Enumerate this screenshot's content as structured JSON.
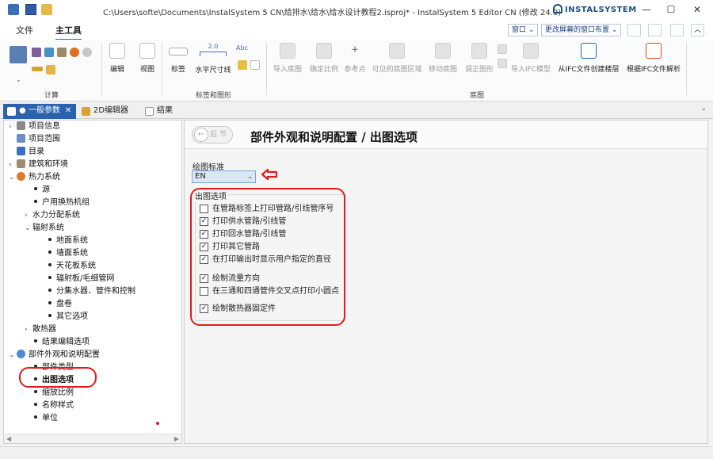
{
  "titlebar": {
    "title": "C:\\Users\\softe\\Documents\\InstalSystem 5 CN\\给排水\\给水\\给水设计教程2.isproj* - InstalSystem 5 Editor CN (修改 24.0)",
    "logo": "INSTALSYSTEM"
  },
  "ribbon_tabs": {
    "file": "文件",
    "main": "主工具",
    "window_label": "窗口",
    "layout_label": "更改屏幕的窗口布置"
  },
  "ribbon": {
    "groups": {
      "calc": "计算",
      "labels": "标签和图形",
      "bottom": "底图"
    },
    "buttons": {
      "edit": "编辑",
      "view": "视图",
      "label": "标签",
      "dim": "水平尺寸线",
      "import_bg": "导入底图",
      "scale": "确定比例",
      "ref": "参考点",
      "visible": "可见的底图区域",
      "move_bg": "移动底图",
      "adjust": "调正图形",
      "import_ifc": "导入IFC模型",
      "ifc_floor": "从IFC文件创建楼层",
      "ifc_parse": "根据IFC文件解析"
    },
    "abc": "Abc",
    "dim_value": "2.0"
  },
  "doctabs": {
    "general": "● 一般参数",
    "editor2d": "2D编辑器",
    "results": "结果"
  },
  "tree": {
    "items": [
      {
        "label": "项目信息"
      },
      {
        "label": "项目范围"
      },
      {
        "label": "目录"
      },
      {
        "label": "建筑和环境"
      },
      {
        "label": "热力系统"
      },
      {
        "label": "源"
      },
      {
        "label": "户用换热机组"
      },
      {
        "label": "水力分配系统"
      },
      {
        "label": "辐射系统"
      },
      {
        "label": "地面系统"
      },
      {
        "label": "墙面系统"
      },
      {
        "label": "天花板系统"
      },
      {
        "label": "辐射板/毛细管网"
      },
      {
        "label": "分集水器、管件和控制"
      },
      {
        "label": "盘卷"
      },
      {
        "label": "其它选项"
      },
      {
        "label": "散热器"
      },
      {
        "label": "结果编辑选项"
      },
      {
        "label": "部件外观和说明配置"
      },
      {
        "label": "部件类型"
      },
      {
        "label": "出图选项"
      },
      {
        "label": "缩放比例"
      },
      {
        "label": "名称样式"
      },
      {
        "label": "单位"
      }
    ]
  },
  "content": {
    "back_label": "后 节",
    "title": "部件外观和说明配置 / 出图选项",
    "standard_label": "绘图标准",
    "standard_value": "EN",
    "options_title": "出图选项",
    "options": [
      {
        "label": "在管路标签上打印管路/引线管序号",
        "checked": false,
        "mark": ""
      },
      {
        "label": "打印供水管路/引线管",
        "checked": true,
        "mark": "✓"
      },
      {
        "label": "打印回水管路/引线管",
        "checked": true,
        "mark": "✓"
      },
      {
        "label": "打印其它管路",
        "checked": true,
        "mark": "✓"
      },
      {
        "label": "在打印输出时显示用户指定的直径",
        "checked": true,
        "mark": "✓"
      },
      {
        "label": "绘制流量方向",
        "checked": true,
        "mark": "✓"
      },
      {
        "label": "在三通和四通管件交叉点打印小圆点",
        "checked": false,
        "mark": ""
      },
      {
        "label": "绘制散热器固定件",
        "checked": true,
        "mark": "✓"
      }
    ]
  },
  "colors": {
    "accent": "#2a62b0",
    "annotation_red": "#e01b1b"
  }
}
